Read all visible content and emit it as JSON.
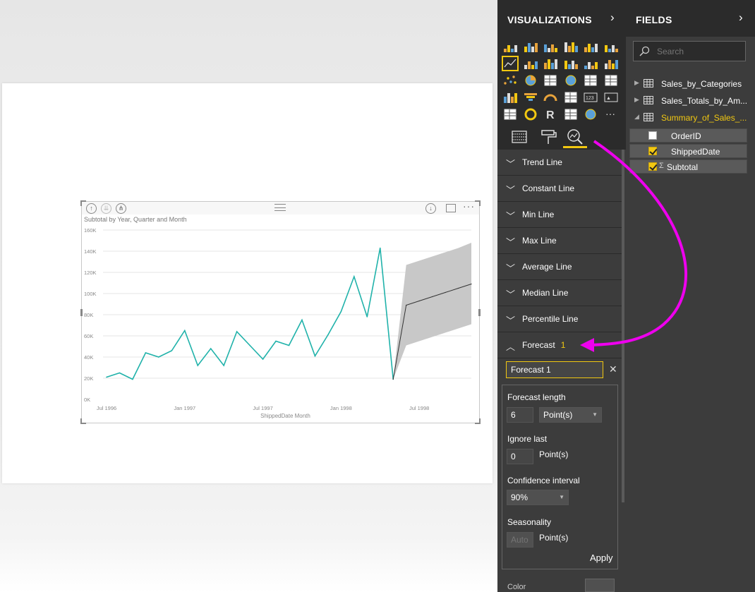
{
  "visualizations_pane": {
    "title": "VISUALIZATIONS",
    "selected_visual": "line-chart",
    "visual_icons": [
      "stacked-bar-chart-icon",
      "stacked-column-chart-icon",
      "clustered-bar-chart-icon",
      "clustered-column-chart-icon",
      "100-stacked-bar-chart-icon",
      "100-stacked-column-chart-icon",
      "line-chart-icon",
      "area-chart-icon",
      "stacked-area-chart-icon",
      "line-and-stacked-column-chart-icon",
      "line-and-clustered-column-chart-icon",
      "ribbon-chart-icon",
      "scatter-chart-icon",
      "pie-chart-icon",
      "treemap-icon",
      "map-icon",
      "table-icon",
      "matrix-icon",
      "filled-map-icon",
      "funnel-icon",
      "gauge-icon",
      "multi-row-card-icon",
      "card-icon",
      "kpi-icon",
      "slicer-icon",
      "donut-chart-icon",
      "r-visual-icon",
      "shape-map-icon",
      "globe-icon",
      "more-visuals-icon"
    ],
    "tabs": [
      "fields-tab",
      "format-tab",
      "analytics-tab"
    ],
    "active_tab": "analytics",
    "analytics_items": [
      {
        "label": "Trend Line",
        "expanded": false
      },
      {
        "label": "Constant Line",
        "expanded": false
      },
      {
        "label": "Min Line",
        "expanded": false
      },
      {
        "label": "Max Line",
        "expanded": false
      },
      {
        "label": "Average Line",
        "expanded": false
      },
      {
        "label": "Median Line",
        "expanded": false
      },
      {
        "label": "Percentile Line",
        "expanded": false
      }
    ],
    "forecast": {
      "label": "Forecast",
      "count": "1",
      "name_value": "Forecast 1",
      "length_label": "Forecast length",
      "length_value": "6",
      "length_unit": "Point(s)",
      "ignore_label": "Ignore last",
      "ignore_value": "0",
      "ignore_unit": "Point(s)",
      "confidence_label": "Confidence interval",
      "confidence_value": "90%",
      "seasonality_label": "Seasonality",
      "seasonality_placeholder": "Auto",
      "seasonality_unit": "Point(s)",
      "apply_label": "Apply"
    },
    "color_label": "Color"
  },
  "fields_pane": {
    "title": "FIELDS",
    "search_placeholder": "Search",
    "tables": [
      {
        "name": "Sales_by_Categories",
        "expanded": false
      },
      {
        "name": "Sales_Totals_by_Am...",
        "expanded": false
      },
      {
        "name": "Summary_of_Sales_...",
        "expanded": true
      }
    ],
    "fields": [
      {
        "name": "OrderID",
        "checked": false,
        "sigma": false
      },
      {
        "name": "ShippedDate",
        "checked": true,
        "sigma": false
      },
      {
        "name": "Subtotal",
        "checked": true,
        "sigma": true
      }
    ]
  },
  "accent_color": "#f2c811",
  "annotation_arrow_color": "#ee00ee",
  "chart_data": {
    "type": "line",
    "title": "Subtotal by Year, Quarter and Month",
    "xlabel": "ShippedDate Month",
    "ylabel": "",
    "x_tick_labels": [
      "Jul 1996",
      "Jan 1997",
      "Jul 1997",
      "Jan 1998",
      "Jul 1998"
    ],
    "y_tick_labels": [
      "0K",
      "20K",
      "40K",
      "60K",
      "80K",
      "100K",
      "120K",
      "140K",
      "160K"
    ],
    "ylim": [
      0,
      160000
    ],
    "grid": true,
    "series": [
      {
        "name": "Subtotal",
        "color": "#20b2aa",
        "x": [
          "Jul 1996",
          "Aug 1996",
          "Sep 1996",
          "Oct 1996",
          "Nov 1996",
          "Dec 1996",
          "Jan 1997",
          "Feb 1997",
          "Mar 1997",
          "Apr 1997",
          "May 1997",
          "Jun 1997",
          "Jul 1997",
          "Aug 1997",
          "Sep 1997",
          "Oct 1997",
          "Nov 1997",
          "Dec 1997",
          "Jan 1998",
          "Feb 1998",
          "Mar 1998",
          "Apr 1998",
          "May 1998"
        ],
        "values": [
          21000,
          25000,
          19000,
          44000,
          40000,
          46000,
          65000,
          32000,
          48000,
          32000,
          64000,
          51000,
          38000,
          55000,
          51000,
          75000,
          41000,
          61000,
          83000,
          116000,
          78000,
          143000,
          19000
        ]
      },
      {
        "name": "Forecast",
        "color": "#333333",
        "x": [
          "May 1998",
          "Jun 1998",
          "Jul 1998",
          "Aug 1998",
          "Sep 1998",
          "Oct 1998",
          "Nov 1998"
        ],
        "values": [
          19000,
          89000,
          93000,
          97000,
          101000,
          105000,
          109000
        ],
        "upper": [
          19000,
          127000,
          131000,
          135000,
          139000,
          143000,
          148000
        ],
        "lower": [
          19000,
          51000,
          55000,
          59000,
          63000,
          67000,
          71000
        ]
      }
    ]
  }
}
